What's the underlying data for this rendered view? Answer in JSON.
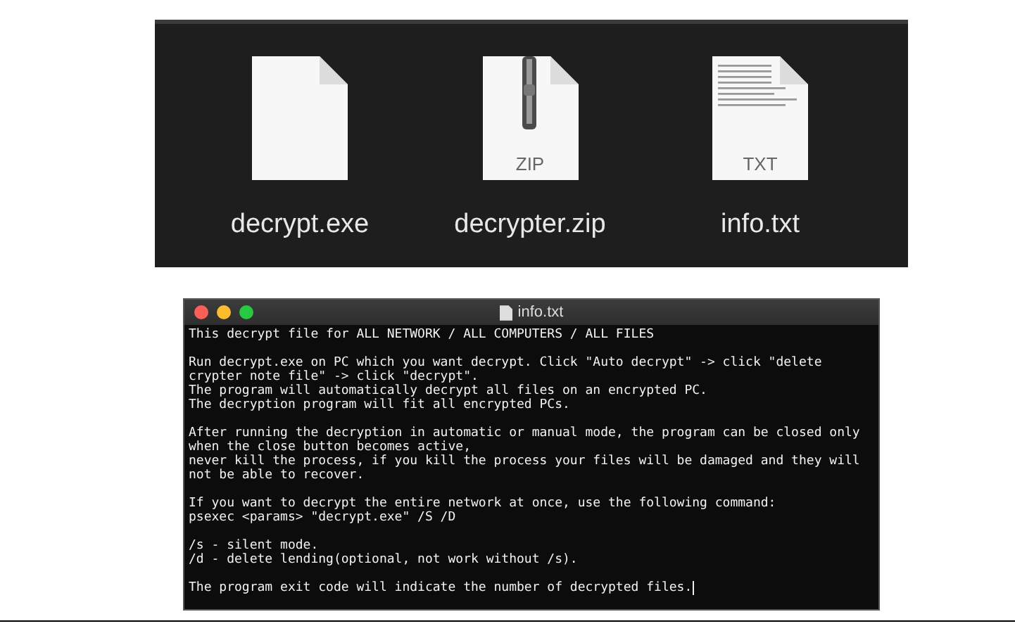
{
  "files": [
    {
      "name": "decrypt.exe",
      "kind": "blank"
    },
    {
      "name": "decrypter.zip",
      "kind": "zip",
      "badge": "ZIP"
    },
    {
      "name": "info.txt",
      "kind": "text",
      "badge": "TXT"
    }
  ],
  "editor": {
    "title": "info.txt",
    "paragraphs": [
      [
        "This decrypt file for ALL NETWORK / ALL COMPUTERS / ALL FILES"
      ],
      [
        "Run decrypt.exe on PC which you want decrypt. Click \"Auto decrypt\" -> click \"delete",
        "crypter note file\" -> click \"decrypt\".",
        "The program will automatically decrypt all files on an encrypted PC.",
        "The decryption program will fit all encrypted PCs."
      ],
      [
        "After running the decryption in automatic or manual mode, the program can be closed only",
        "when the close button becomes active,",
        "never kill the process, if you kill the process your files will be damaged and they will",
        "not be able to recover."
      ],
      [
        "If you want to decrypt the entire network at once, use the following command:",
        "psexec <params> \"decrypt.exe\" /S /D"
      ],
      [
        "/s - silent mode.",
        "/d - delete lending(optional, not work without /s)."
      ],
      [
        "The program exit code will indicate the number of decrypted files."
      ]
    ]
  }
}
